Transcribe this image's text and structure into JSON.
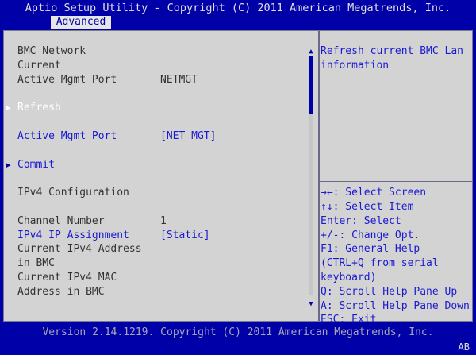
{
  "header": {
    "title": "Aptio Setup Utility - Copyright (C) 2011 American Megatrends, Inc."
  },
  "tabs": [
    {
      "label": "Advanced"
    }
  ],
  "left": {
    "bmc_network": "BMC Network",
    "current": "Current",
    "active_mgmt_port_label": "Active Mgmt Port",
    "active_mgmt_port_value": "NETMGT",
    "refresh": "Refresh",
    "active_mgmt_port_select_label": "Active Mgmt Port",
    "active_mgmt_port_select_value": "[NET MGT]",
    "commit": "Commit",
    "ipv4_configuration": "IPv4 Configuration",
    "channel_number_label": "Channel Number",
    "channel_number_value": "1",
    "ipv4_ip_assignment_label": "IPv4 IP Assignment",
    "ipv4_ip_assignment_value": "[Static]",
    "current_ipv4_address_line1": "Current IPv4 Address",
    "current_ipv4_address_line2": "in BMC",
    "current_ipv4_mac_line1": "Current IPv4 MAC",
    "current_ipv4_mac_line2": "Address in BMC"
  },
  "help": {
    "line1": "Refresh current BMC Lan",
    "line2": "information"
  },
  "keys": [
    "→←: Select Screen",
    "↑↓: Select Item",
    "Enter: Select",
    "+/-: Change Opt.",
    "F1: General Help",
    "(CTRL+Q from serial",
    "keyboard)",
    "Q: Scroll Help Pane Up",
    "A: Scroll Help Pane Down",
    "ESC: Exit"
  ],
  "footer": {
    "version": "Version 2.14.1219. Copyright (C) 2011 American Megatrends, Inc."
  },
  "status": {
    "indicator": "AB"
  },
  "icons": {
    "scroll_up": "up-triangle",
    "scroll_down": "down-triangle",
    "submenu": "right-triangle"
  }
}
